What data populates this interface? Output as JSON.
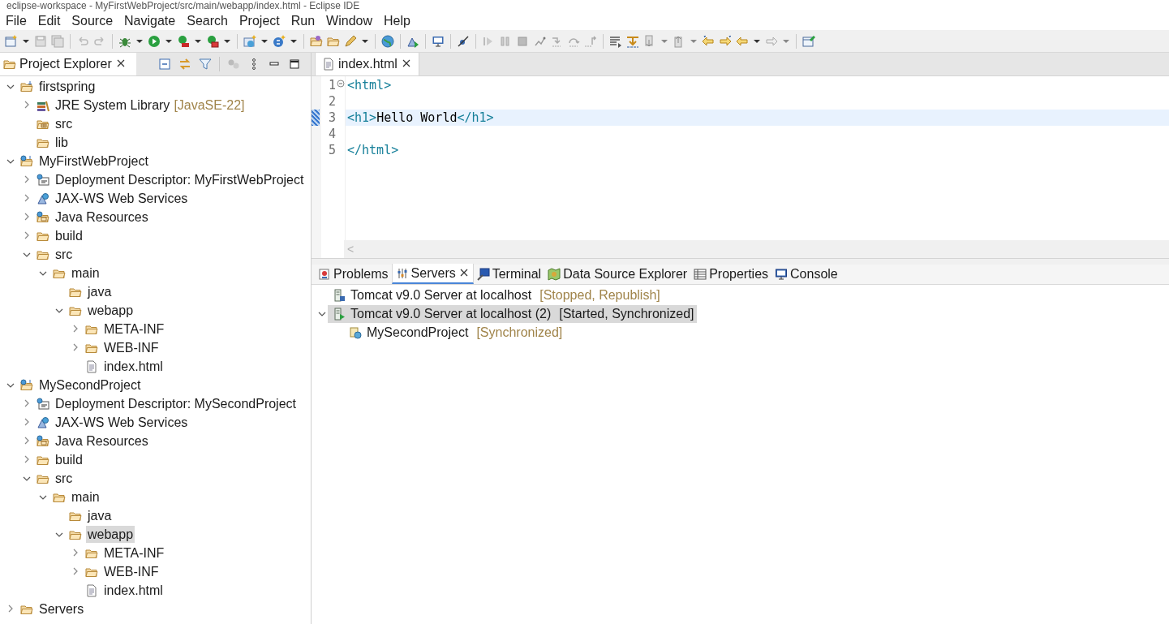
{
  "window": {
    "title": "eclipse-workspace - MyFirstWebProject/src/main/webapp/index.html - Eclipse IDE"
  },
  "menu": [
    "File",
    "Edit",
    "Source",
    "Navigate",
    "Search",
    "Project",
    "Run",
    "Window",
    "Help"
  ],
  "project_explorer": {
    "tab": {
      "label": "Project Explorer",
      "selected": true
    },
    "tree": [
      {
        "label": "firstspring",
        "kind": "project",
        "expanded": true,
        "selected": false,
        "children": [
          {
            "label": "JRE System Library",
            "decoration": "[JavaSE-22]",
            "kind": "library",
            "expanded": false,
            "selected": false
          },
          {
            "label": "src",
            "kind": "package-folder",
            "selected": false
          },
          {
            "label": "lib",
            "kind": "folder",
            "selected": false
          }
        ]
      },
      {
        "label": "MyFirstWebProject",
        "kind": "web-project",
        "expanded": true,
        "selected": false,
        "children": [
          {
            "label": "Deployment Descriptor: MyFirstWebProject",
            "kind": "descriptor",
            "expanded": false,
            "selected": false
          },
          {
            "label": "JAX-WS Web Services",
            "kind": "webservices",
            "expanded": false,
            "selected": false
          },
          {
            "label": "Java Resources",
            "kind": "java-resources",
            "expanded": false,
            "selected": false
          },
          {
            "label": "build",
            "kind": "folder",
            "expanded": false,
            "selected": false
          },
          {
            "label": "src",
            "kind": "folder",
            "expanded": true,
            "selected": false,
            "children": [
              {
                "label": "main",
                "kind": "folder",
                "expanded": true,
                "selected": false,
                "children": [
                  {
                    "label": "java",
                    "kind": "folder",
                    "selected": false
                  },
                  {
                    "label": "webapp",
                    "kind": "folder",
                    "expanded": true,
                    "selected": false,
                    "children": [
                      {
                        "label": "META-INF",
                        "kind": "folder",
                        "expanded": false,
                        "selected": false
                      },
                      {
                        "label": "WEB-INF",
                        "kind": "folder",
                        "expanded": false,
                        "selected": false
                      },
                      {
                        "label": "index.html",
                        "kind": "file",
                        "selected": false
                      }
                    ]
                  }
                ]
              }
            ]
          }
        ]
      },
      {
        "label": "MySecondProject",
        "kind": "web-project",
        "expanded": true,
        "selected": false,
        "children": [
          {
            "label": "Deployment Descriptor: MySecondProject",
            "kind": "descriptor",
            "expanded": false,
            "selected": false
          },
          {
            "label": "JAX-WS Web Services",
            "kind": "webservices",
            "expanded": false,
            "selected": false
          },
          {
            "label": "Java Resources",
            "kind": "java-resources",
            "expanded": false,
            "selected": false
          },
          {
            "label": "build",
            "kind": "folder",
            "expanded": false,
            "selected": false
          },
          {
            "label": "src",
            "kind": "folder",
            "expanded": true,
            "selected": false,
            "children": [
              {
                "label": "main",
                "kind": "folder",
                "expanded": true,
                "selected": false,
                "children": [
                  {
                    "label": "java",
                    "kind": "folder",
                    "selected": false
                  },
                  {
                    "label": "webapp",
                    "kind": "folder",
                    "expanded": true,
                    "selected": true,
                    "children": [
                      {
                        "label": "META-INF",
                        "kind": "folder",
                        "expanded": false,
                        "selected": false
                      },
                      {
                        "label": "WEB-INF",
                        "kind": "folder",
                        "expanded": false,
                        "selected": false
                      },
                      {
                        "label": "index.html",
                        "kind": "file",
                        "selected": false
                      }
                    ]
                  }
                ]
              }
            ]
          }
        ]
      },
      {
        "label": "Servers",
        "kind": "folder",
        "expanded": false,
        "selected": false
      }
    ]
  },
  "editor": {
    "tab": {
      "label": "index.html",
      "selected": true
    },
    "lines": [
      {
        "number": "1",
        "foldable": true,
        "tokens": [
          {
            "text": "<html>",
            "kind": "tag"
          }
        ]
      },
      {
        "number": "2"
      },
      {
        "number": "3",
        "current": true,
        "tokens": [
          {
            "text": "<h1>",
            "kind": "tag"
          },
          {
            "text": "Hello World",
            "kind": "text"
          },
          {
            "text": "</h1>",
            "kind": "tag"
          }
        ]
      },
      {
        "number": "4"
      },
      {
        "number": "5",
        "tokens": [
          {
            "text": "</html>",
            "kind": "tag"
          }
        ]
      }
    ],
    "scroll_left": "<"
  },
  "bottom_panel": {
    "tabs": [
      {
        "label": "Problems",
        "kind": "problems",
        "selected": false
      },
      {
        "label": "Servers",
        "kind": "servers",
        "selected": true
      },
      {
        "label": "Terminal",
        "kind": "terminal",
        "selected": false
      },
      {
        "label": "Data Source Explorer",
        "kind": "datasource",
        "selected": false
      },
      {
        "label": "Properties",
        "kind": "properties",
        "selected": false
      },
      {
        "label": "Console",
        "kind": "console",
        "selected": false
      }
    ],
    "servers": [
      {
        "label": "Tomcat v9.0 Server at localhost",
        "status": "[Stopped, Republish]",
        "kind": "server-stopped",
        "selected": false
      },
      {
        "label": "Tomcat v9.0 Server at localhost (2)",
        "status": "[Started, Synchronized]",
        "kind": "server-started",
        "expanded": true,
        "selected": true,
        "children": [
          {
            "label": "MySecondProject",
            "status": "[Synchronized]",
            "kind": "module",
            "selected": false
          }
        ]
      }
    ]
  }
}
